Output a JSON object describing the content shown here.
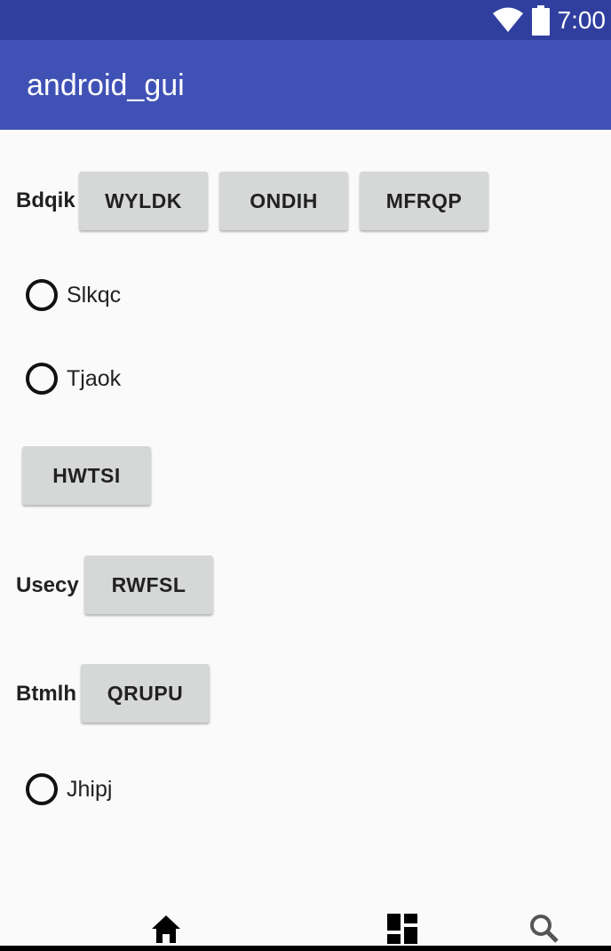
{
  "status_bar": {
    "time": "7:00",
    "wifi_icon": "wifi-icon",
    "battery_icon": "battery-icon"
  },
  "app_bar": {
    "title": "android_gui"
  },
  "rows": {
    "bdqik": {
      "label": "Bdqik",
      "buttons": [
        "WYLDK",
        "ONDIH",
        "MFRQP"
      ]
    },
    "radio1": {
      "label": "Slkqc",
      "checked": false
    },
    "radio2": {
      "label": "Tjaok",
      "checked": false
    },
    "hwtsi": {
      "button": "HWTSI"
    },
    "usecy": {
      "label": "Usecy",
      "button": "RWFSL"
    },
    "btmlh": {
      "label": "Btmlh",
      "button": "QRUPU"
    },
    "radio3": {
      "label": "Jhipj",
      "checked": false
    }
  },
  "bottom_nav": {
    "icons": [
      "home-icon",
      "dashboard-icon",
      "search-icon"
    ]
  }
}
